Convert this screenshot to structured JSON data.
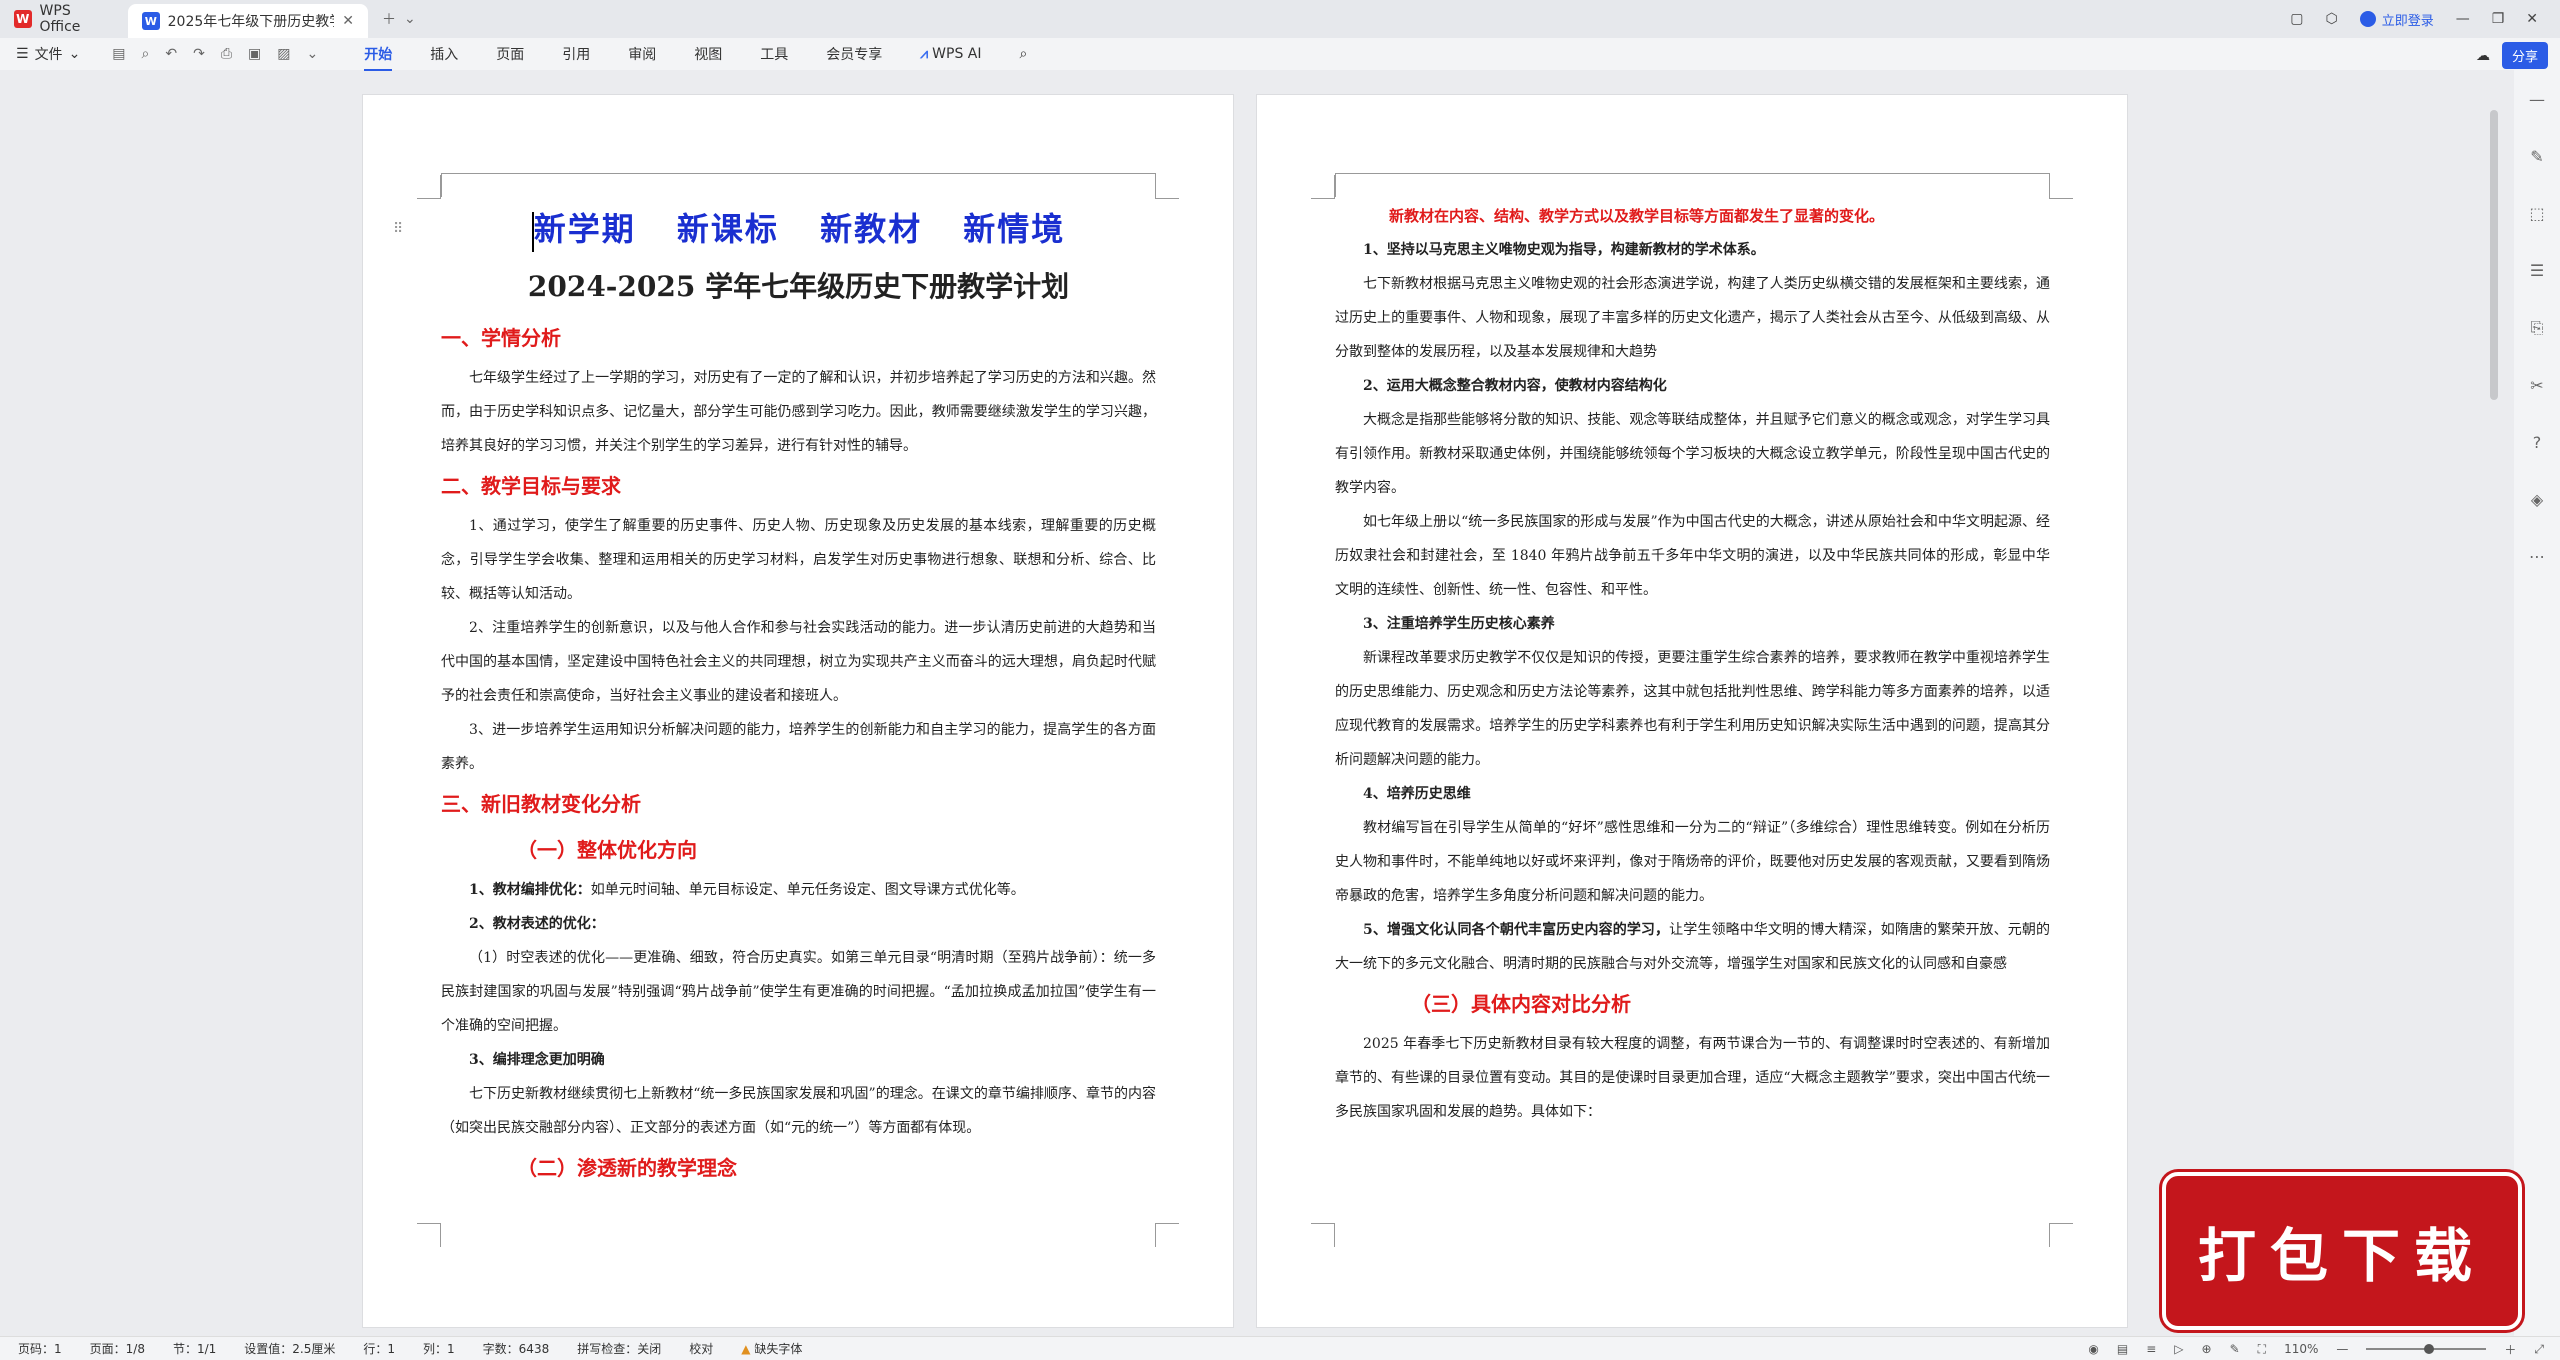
{
  "titlebar": {
    "app_name": "WPS Office",
    "doc_tab": "2025年七年级下册历史教学计",
    "login": "立即登录"
  },
  "ribbon": {
    "file": "文件",
    "tabs": [
      "开始",
      "插入",
      "页面",
      "引用",
      "审阅",
      "视图",
      "工具",
      "会员专享"
    ],
    "ai": "WPS AI",
    "share": "分享"
  },
  "left_page": {
    "slogan": "新学期 新课标 新教材 新情境",
    "title": "2024-2025 学年七年级历史下册教学计划",
    "s1": "一、学情分析",
    "p1": "七年级学生经过了上一学期的学习，对历史有了一定的了解和认识，并初步培养起了学习历史的方法和兴趣。然而，由于历史学科知识点多、记忆量大，部分学生可能仍感到学习吃力。因此，教师需要继续激发学生的学习兴趣，培养其良好的学习习惯，并关注个别学生的学习差异，进行有针对性的辅导。",
    "s2": "二、教学目标与要求",
    "p2": "1、通过学习，使学生了解重要的历史事件、历史人物、历史现象及历史发展的基本线索，理解重要的历史概念，引导学生学会收集、整理和运用相关的历史学习材料，启发学生对历史事物进行想象、联想和分析、综合、比较、概括等认知活动。",
    "p3": "2、注重培养学生的创新意识，以及与他人合作和参与社会实践活动的能力。进一步认清历史前进的大趋势和当代中国的基本国情，坚定建设中国特色社会主义的共同理想，树立为实现共产主义而奋斗的远大理想，肩负起时代赋予的社会责任和崇高使命，当好社会主义事业的建设者和接班人。",
    "p4": "3、进一步培养学生运用知识分析解决问题的能力，培养学生的创新能力和自主学习的能力，提高学生的各方面素养。",
    "s3": "三、新旧教材变化分析",
    "s3a": "（一）整体优化方向",
    "b1_title": "1、教材编排优化：",
    "b1_text": "如单元时间轴、单元目标设定、单元任务设定、图文导课方式优化等。",
    "b2_title": "2、教材表述的优化：",
    "p5": "（1）时空表述的优化——更准确、细致，符合历史真实。如第三单元目录“明清时期（至鸦片战争前）：统一多民族封建国家的巩固与发展”特别强调“鸦片战争前”使学生有更准确的时间把握。“孟加拉换成孟加拉国”使学生有一个准确的空间把握。",
    "b3_title": "3、编排理念更加明确",
    "p6": "七下历史新教材继续贯彻七上新教材“统一多民族国家发展和巩固”的理念。在课文的章节编排顺序、章节的内容（如突出民族交融部分内容）、正文部分的表述方面（如“元的统一”）等方面都有体现。",
    "s3b": "（二）渗透新的教学理念"
  },
  "right_page": {
    "red_intro": "新教材在内容、结构、教学方式以及教学目标等方面都发生了显著的变化。",
    "r1_title": "1、坚持以马克思主义唯物史观为指导，构建新教材的学术体系。",
    "r1_text": "七下新教材根据马克思主义唯物史观的社会形态演进学说，构建了人类历史纵横交错的发展框架和主要线索，通过历史上的重要事件、人物和现象，展现了丰富多样的历史文化遗产，揭示了人类社会从古至今、从低级到高级、从分散到整体的发展历程，以及基本发展规律和大趋势",
    "r2_title": "2、运用大概念整合教材内容，使教材内容结构化",
    "r2_text": "大概念是指那些能够将分散的知识、技能、观念等联结成整体，并且赋予它们意义的概念或观念，对学生学习具有引领作用。新教材采取通史体例，并围绕能够统领每个学习板块的大概念设立教学单元，阶段性呈现中国古代史的教学内容。",
    "r2_text2": "如七年级上册以“统一多民族国家的形成与发展”作为中国古代史的大概念，讲述从原始社会和中华文明起源、经历奴隶社会和封建社会，至 1840 年鸦片战争前五千多年中华文明的演进，以及中华民族共同体的形成，彰显中华文明的连续性、创新性、统一性、包容性、和平性。",
    "r3_title": "3、注重培养学生历史核心素养",
    "r3_text": "新课程改革要求历史教学不仅仅是知识的传授，更要注重学生综合素养的培养，要求教师在教学中重视培养学生的历史思维能力、历史观念和历史方法论等素养，这其中就包括批判性思维、跨学科能力等多方面素养的培养，以适应现代教育的发展需求。培养学生的历史学科素养也有利于学生利用历史知识解决实际生活中遇到的问题，提高其分析问题解决问题的能力。",
    "r4_title": "4、培养历史思维",
    "r4_text": "教材编写旨在引导学生从简单的“好坏”感性思维和一分为二的“辩证”（多维综合）理性思维转变。例如在分析历史人物和事件时，不能单纯地以好或坏来评判，像对于隋炀帝的评价，既要他对历史发展的客观贡献，又要看到隋炀帝暴政的危害，培养学生多角度分析问题和解决问题的能力。",
    "r5_title": "5、增强文化认同各个朝代丰富历史内容的学习，",
    "r5_text": "让学生领略中华文明的博大精深，如隋唐的繁荣开放、元朝的大一统下的多元文化融合、明清时期的民族融合与对外交流等，增强学生对国家和民族文化的认同感和自豪感",
    "s3c": "（三）具体内容对比分析",
    "r6_text": "2025 年春季七下历史新教材目录有较大程度的调整，有两节课合为一节的、有调整课时时空表述的、有新增加章节的、有些课的目录位置有变动。其目的是使课时目录更加合理，适应“大概念主题教学”要求，突出中国古代统一多民族国家巩固和发展的趋势。具体如下："
  },
  "statusbar": {
    "page_no": "页码：1",
    "pages": "页面：1/8",
    "section": "节：1/1",
    "setting": "设置值：2.5厘米",
    "row": "行：1",
    "col": "列：1",
    "words": "字数：6438",
    "spell": "拼写检查：关闭",
    "proof": "校对",
    "font_missing": "缺失字体",
    "zoom": "110%"
  },
  "banner": {
    "text": "打包下载"
  }
}
